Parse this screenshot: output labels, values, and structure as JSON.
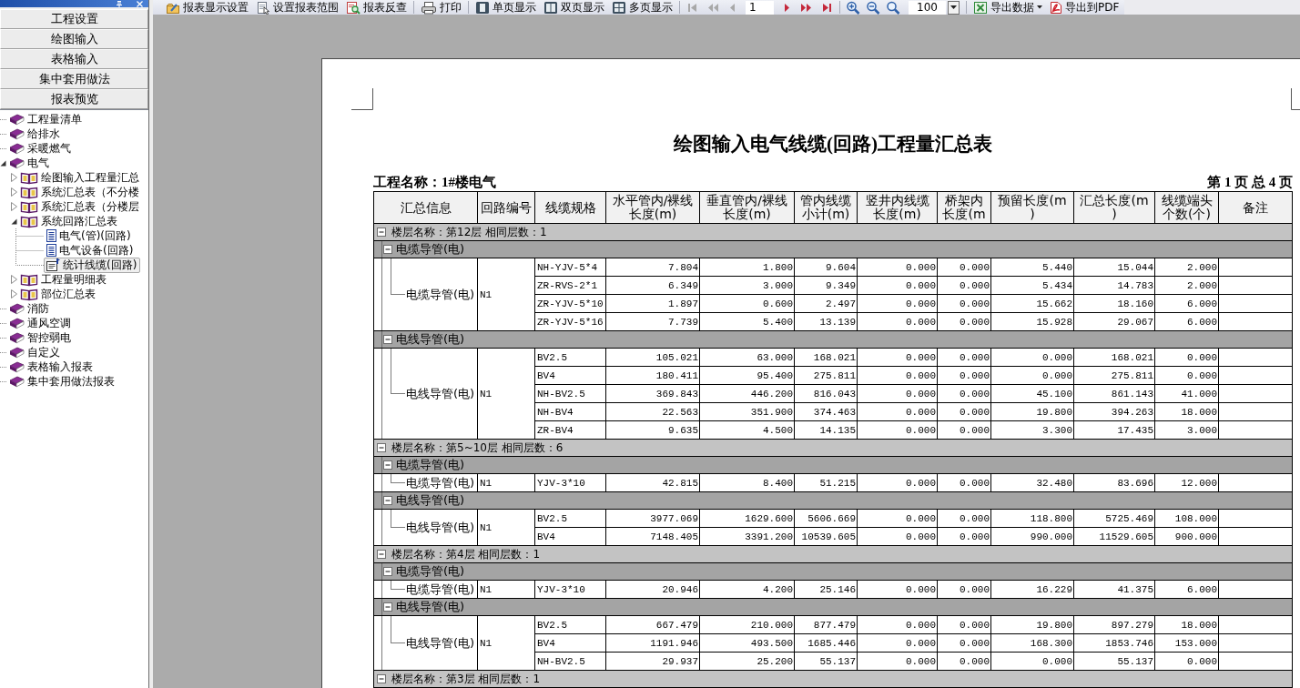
{
  "navigator": {
    "buttons": [
      "工程设置",
      "绘图输入",
      "表格输入",
      "集中套用做法",
      "报表预览"
    ],
    "tree": [
      {
        "label": "工程量清单",
        "kind": "book",
        "expanded": false,
        "selected": false
      },
      {
        "label": "给排水",
        "kind": "book",
        "expanded": false,
        "selected": false
      },
      {
        "label": "采暖燃气",
        "kind": "book",
        "expanded": false,
        "selected": false
      },
      {
        "label": "电气",
        "kind": "book",
        "expanded": true,
        "selected": false,
        "children": [
          {
            "label": "绘图输入工程量汇总",
            "kind": "open-book",
            "expanded": false,
            "selected": false
          },
          {
            "label": "系统汇总表（不分楼",
            "kind": "open-book",
            "expanded": false,
            "selected": false
          },
          {
            "label": "系统汇总表（分楼层",
            "kind": "open-book",
            "expanded": false,
            "selected": false
          },
          {
            "label": "系统回路汇总表",
            "kind": "open-book",
            "expanded": true,
            "selected": false,
            "children": [
              {
                "label": "电气(管)(回路)",
                "kind": "report",
                "selected": false
              },
              {
                "label": "电气设备(回路)",
                "kind": "report",
                "selected": false
              },
              {
                "label": "统计线缆(回路)",
                "kind": "report",
                "selected": true
              }
            ]
          },
          {
            "label": "工程量明细表",
            "kind": "open-book",
            "expanded": false,
            "selected": false
          },
          {
            "label": "部位汇总表",
            "kind": "open-book",
            "expanded": false,
            "selected": false
          }
        ]
      },
      {
        "label": "消防",
        "kind": "book",
        "expanded": false,
        "selected": false
      },
      {
        "label": "通风空调",
        "kind": "book",
        "expanded": false,
        "selected": false
      },
      {
        "label": "智控弱电",
        "kind": "book",
        "expanded": false,
        "selected": false
      },
      {
        "label": "自定义",
        "kind": "book",
        "expanded": false,
        "selected": false
      },
      {
        "label": "表格输入报表",
        "kind": "book",
        "expanded": false,
        "selected": false
      },
      {
        "label": "集中套用做法报表",
        "kind": "book",
        "expanded": false,
        "selected": false
      }
    ]
  },
  "toolbar": {
    "report_buttons": [
      "报表显示设置",
      "设置报表范围",
      "报表反查"
    ],
    "print_button": "打印",
    "view_buttons": [
      "单页显示",
      "双页显示",
      "多页显示"
    ],
    "page_nav": [
      {
        "disabled": true
      },
      {
        "disabled": true
      },
      {
        "disabled": true
      },
      {
        "disabled": false
      },
      {
        "disabled": false
      },
      {
        "disabled": false
      }
    ],
    "page_field": "1",
    "zoom_field": "100",
    "export_buttons": [
      {
        "label": "导出数据",
        "menu": true
      },
      {
        "label": "导出到PDF"
      }
    ]
  },
  "report": {
    "title": "绘图输入电气线缆(回路)工程量汇总表",
    "project": "工程名称：1#楼电气",
    "page_info": "第 1 页 总 4 页",
    "columns": [
      "汇总信息",
      "回路编号",
      "线缆规格",
      "水平管内/裸线长度(m)",
      "垂直管内/裸线长度(m)",
      "管内线缆小计(m)",
      "竖井内线缆长度(m)",
      "桥架内长度(m",
      "预留长度(m)",
      "汇总长度(m)",
      "线缆端头个数(个)",
      "备注"
    ],
    "floors": [
      {
        "label": "楼层名称：第12层 相同层数：1",
        "expanded": true,
        "groups": [
          {
            "label": "电缆导管(电)",
            "expanded": true,
            "summary": "电缆导管(电)",
            "circuit": "N1",
            "rows": [
              {
                "spec": "NH-YJV-5*4",
                "values": [
                  "7.804",
                  "1.800",
                  "9.604",
                  "0.000",
                  "0.000",
                  "5.440",
                  "15.044",
                  "2.000"
                ]
              },
              {
                "spec": "ZR-RVS-2*1",
                "values": [
                  "6.349",
                  "3.000",
                  "9.349",
                  "0.000",
                  "0.000",
                  "5.434",
                  "14.783",
                  "2.000"
                ]
              },
              {
                "spec": "ZR-YJV-5*10",
                "values": [
                  "1.897",
                  "0.600",
                  "2.497",
                  "0.000",
                  "0.000",
                  "15.662",
                  "18.160",
                  "6.000"
                ]
              },
              {
                "spec": "ZR-YJV-5*16",
                "values": [
                  "7.739",
                  "5.400",
                  "13.139",
                  "0.000",
                  "0.000",
                  "15.928",
                  "29.067",
                  "6.000"
                ]
              }
            ]
          },
          {
            "label": "电线导管(电)",
            "expanded": true,
            "summary": "电线导管(电)",
            "circuit": "N1",
            "rows": [
              {
                "spec": "BV2.5",
                "values": [
                  "105.021",
                  "63.000",
                  "168.021",
                  "0.000",
                  "0.000",
                  "0.000",
                  "168.021",
                  "0.000"
                ]
              },
              {
                "spec": "BV4",
                "values": [
                  "180.411",
                  "95.400",
                  "275.811",
                  "0.000",
                  "0.000",
                  "0.000",
                  "275.811",
                  "0.000"
                ]
              },
              {
                "spec": "NH-BV2.5",
                "values": [
                  "369.843",
                  "446.200",
                  "816.043",
                  "0.000",
                  "0.000",
                  "45.100",
                  "861.143",
                  "41.000"
                ]
              },
              {
                "spec": "NH-BV4",
                "values": [
                  "22.563",
                  "351.900",
                  "374.463",
                  "0.000",
                  "0.000",
                  "19.800",
                  "394.263",
                  "18.000"
                ]
              },
              {
                "spec": "ZR-BV4",
                "values": [
                  "9.635",
                  "4.500",
                  "14.135",
                  "0.000",
                  "0.000",
                  "3.300",
                  "17.435",
                  "3.000"
                ]
              }
            ]
          }
        ]
      },
      {
        "label": "楼层名称：第5~10层 相同层数：6",
        "expanded": true,
        "groups": [
          {
            "label": "电缆导管(电)",
            "expanded": true,
            "summary": "电缆导管(电)",
            "circuit": "N1",
            "rows": [
              {
                "spec": "YJV-3*10",
                "values": [
                  "42.815",
                  "8.400",
                  "51.215",
                  "0.000",
                  "0.000",
                  "32.480",
                  "83.696",
                  "12.000"
                ]
              }
            ]
          },
          {
            "label": "电线导管(电)",
            "expanded": true,
            "summary": "电线导管(电)",
            "circuit": "N1",
            "rows": [
              {
                "spec": "BV2.5",
                "values": [
                  "3977.069",
                  "1629.600",
                  "5606.669",
                  "0.000",
                  "0.000",
                  "118.800",
                  "5725.469",
                  "108.000"
                ]
              },
              {
                "spec": "BV4",
                "values": [
                  "7148.405",
                  "3391.200",
                  "10539.605",
                  "0.000",
                  "0.000",
                  "990.000",
                  "11529.605",
                  "900.000"
                ]
              }
            ]
          }
        ]
      },
      {
        "label": "楼层名称：第4层 相同层数：1",
        "expanded": true,
        "groups": [
          {
            "label": "电缆导管(电)",
            "expanded": true,
            "summary": "电缆导管(电)",
            "circuit": "N1",
            "rows": [
              {
                "spec": "YJV-3*10",
                "values": [
                  "20.946",
                  "4.200",
                  "25.146",
                  "0.000",
                  "0.000",
                  "16.229",
                  "41.375",
                  "6.000"
                ]
              }
            ]
          },
          {
            "label": "电线导管(电)",
            "expanded": true,
            "summary": "电线导管(电)",
            "circuit": "N1",
            "rows": [
              {
                "spec": "BV2.5",
                "values": [
                  "667.479",
                  "210.000",
                  "877.479",
                  "0.000",
                  "0.000",
                  "19.800",
                  "897.279",
                  "18.000"
                ]
              },
              {
                "spec": "BV4",
                "values": [
                  "1191.946",
                  "493.500",
                  "1685.446",
                  "0.000",
                  "0.000",
                  "168.300",
                  "1853.746",
                  "153.000"
                ]
              },
              {
                "spec": "NH-BV2.5",
                "values": [
                  "29.937",
                  "25.200",
                  "55.137",
                  "0.000",
                  "0.000",
                  "0.000",
                  "55.137",
                  "0.000"
                ]
              }
            ]
          }
        ]
      },
      {
        "label": "楼层名称：第3层 相同层数：1",
        "expanded": true
      }
    ]
  }
}
